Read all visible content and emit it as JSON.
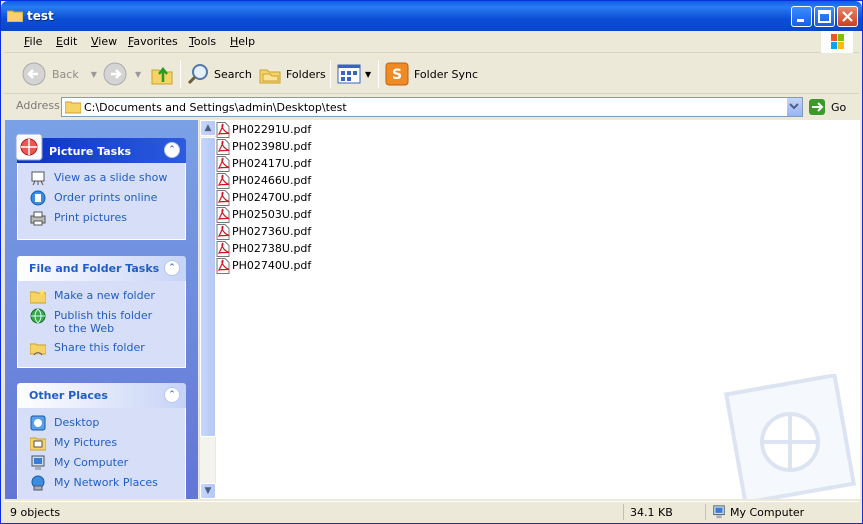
{
  "window": {
    "title": "test",
    "colors": {
      "titlebar": "#0a5fe8",
      "taskpane": "#6375d6",
      "link": "#215dc6"
    }
  },
  "menu": {
    "items": [
      {
        "label": "File",
        "key": "F",
        "rest": "ile"
      },
      {
        "label": "Edit",
        "key": "E",
        "rest": "dit"
      },
      {
        "label": "View",
        "key": "V",
        "rest": "iew"
      },
      {
        "label": "Favorites",
        "key": "F",
        "rest": "avorites"
      },
      {
        "label": "Tools",
        "key": "T",
        "rest": "ools"
      },
      {
        "label": "Help",
        "key": "H",
        "rest": "elp"
      }
    ]
  },
  "toolbar": {
    "back": "Back",
    "search": "Search",
    "folders": "Folders",
    "folder_sync": "Folder Sync"
  },
  "address": {
    "label": "Address",
    "value": "C:\\Documents and Settings\\admin\\Desktop\\test",
    "go": "Go"
  },
  "tasks": {
    "picture": {
      "title": "Picture Tasks",
      "items": [
        "View as a slide show",
        "Order prints online",
        "Print pictures"
      ]
    },
    "file_folder": {
      "title": "File and Folder Tasks",
      "items": [
        "Make a new folder",
        "Publish this folder to the Web",
        "Share this folder"
      ]
    },
    "other": {
      "title": "Other Places",
      "items": [
        "Desktop",
        "My Pictures",
        "My Computer",
        "My Network Places"
      ]
    }
  },
  "files": [
    "PH02291U.pdf",
    "PH02398U.pdf",
    "PH02417U.pdf",
    "PH02466U.pdf",
    "PH02470U.pdf",
    "PH02503U.pdf",
    "PH02736U.pdf",
    "PH02738U.pdf",
    "PH02740U.pdf"
  ],
  "status": {
    "count": "9 objects",
    "size": "34.1 KB",
    "location": "My Computer"
  }
}
